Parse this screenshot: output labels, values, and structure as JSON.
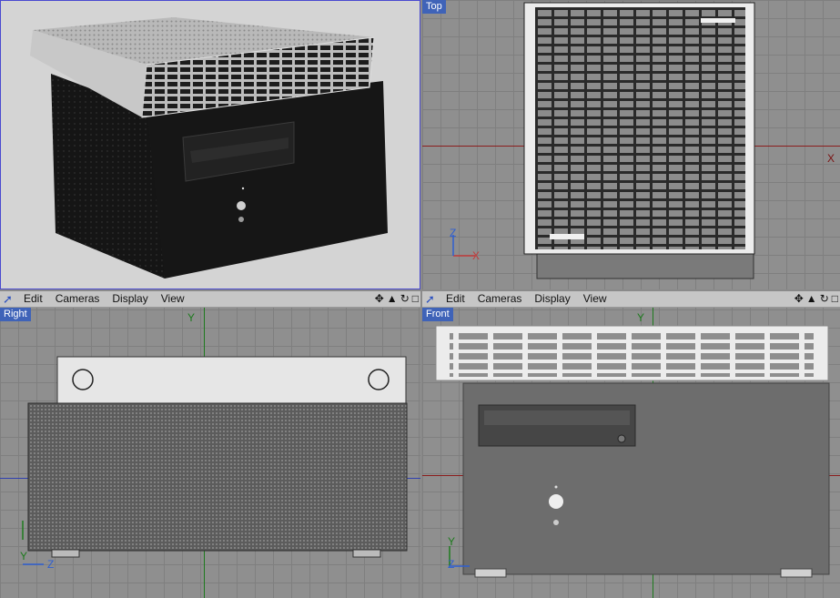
{
  "menu": {
    "items": [
      "Edit",
      "Cameras",
      "Display",
      "View"
    ]
  },
  "viewports": {
    "top": {
      "label": "Top",
      "axis_x": "X",
      "gizmo_x": "X",
      "gizmo_z": "Z"
    },
    "right": {
      "label": "Right",
      "axis_y": "Y",
      "gizmo_y": "Y",
      "gizmo_z": "Z"
    },
    "front": {
      "label": "Front",
      "axis_y": "Y",
      "gizmo_y": "Y",
      "gizmo_z": "Z"
    }
  },
  "nav_icons": [
    "move-view-icon",
    "zoom-view-icon",
    "rotate-view-icon",
    "maximize-view-icon"
  ],
  "colors": {
    "viewport_bg": "#8f8f8f",
    "perspective_bg": "#d4d4d4",
    "label_bg": "#3f63b8",
    "x_axis": "#8b1d1d",
    "y_axis": "#1d7a1d"
  }
}
